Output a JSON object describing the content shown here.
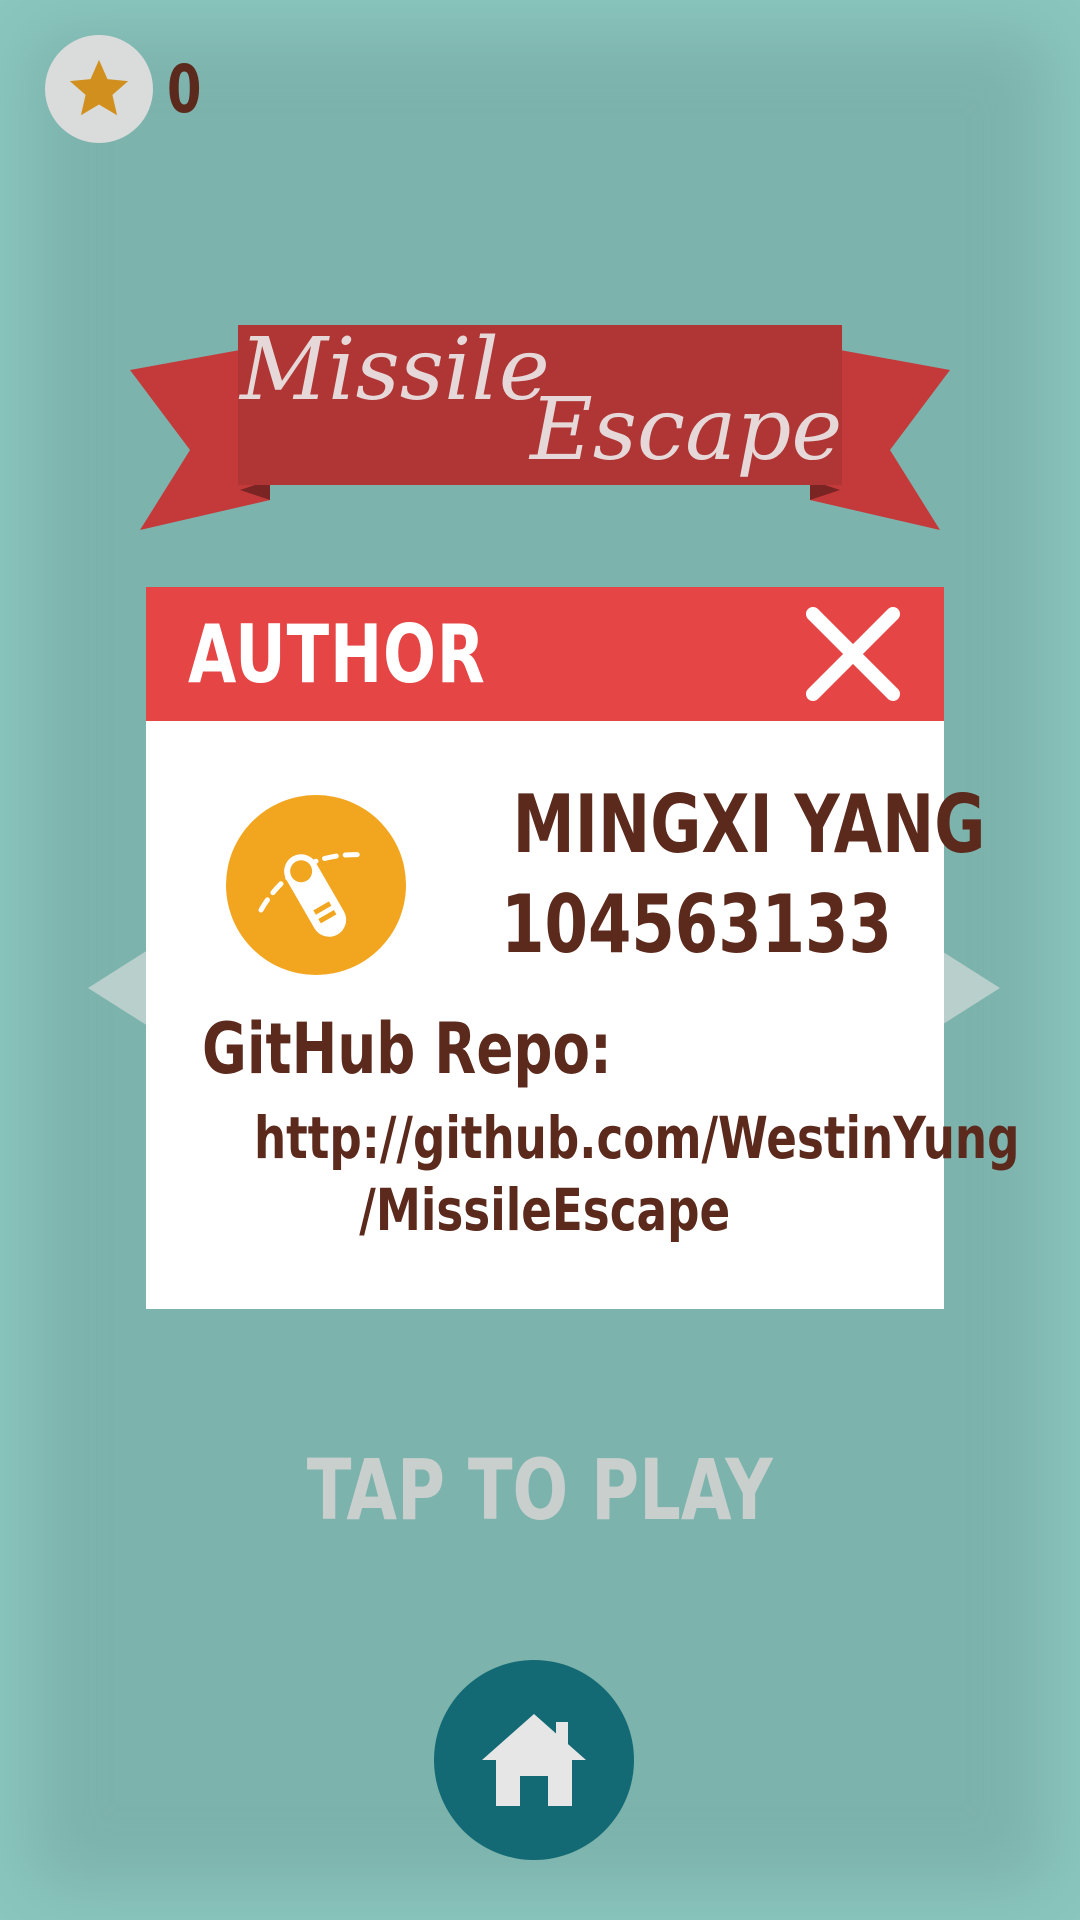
{
  "hud": {
    "star_count": "0",
    "star_icon": "star-icon"
  },
  "title_banner": {
    "line1": "Missile",
    "line2": "Escape",
    "ribbon_color": "#b03535"
  },
  "dialog": {
    "title": "AUTHOR",
    "close_icon": "close-icon",
    "logo_icon": "finger-swipe-icon",
    "author_name": "MINGXI YANG",
    "author_id": "104563133",
    "repo_label": "GitHub Repo:",
    "repo_url_line1": "http://github.com/WestinYung",
    "repo_url_line2": "/MissileEscape",
    "header_color": "#e64545"
  },
  "tap_to_play": "TAP TO PLAY",
  "home_button": {
    "icon": "home-icon",
    "color": "#136a74"
  }
}
